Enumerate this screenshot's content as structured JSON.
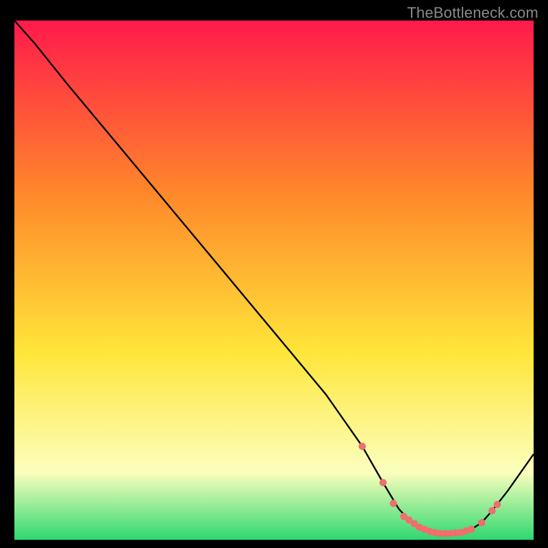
{
  "watermark": "TheBottleneck.com",
  "colors": {
    "bg": "#000000",
    "watermark": "#8a8a8a",
    "line": "#000000",
    "dot": "#ef6e6e",
    "grad_top": "#ff1a4b",
    "grad_orange": "#ff8a2a",
    "grad_yellow": "#ffe63a",
    "grad_lightyellow": "#fbffbd",
    "grad_green": "#2ed86f"
  },
  "chart_data": {
    "type": "line",
    "title": "",
    "xlabel": "",
    "ylabel": "",
    "xlim": [
      0,
      100
    ],
    "ylim": [
      0,
      100
    ],
    "series": [
      {
        "name": "curve",
        "x": [
          0,
          4,
          10,
          20,
          30,
          40,
          50,
          60,
          67,
          71,
          74,
          76,
          78,
          80,
          82,
          84,
          86,
          88,
          90,
          92,
          95,
          100
        ],
        "values": [
          100,
          95.5,
          88,
          76,
          64,
          52,
          40,
          28,
          18,
          11,
          6,
          3.8,
          2.4,
          1.6,
          1.2,
          1.2,
          1.4,
          2.0,
          3.3,
          5.6,
          9.4,
          16.5
        ]
      }
    ],
    "markers": {
      "name": "dots",
      "x": [
        67,
        71,
        73,
        75,
        76,
        77,
        78,
        79,
        80,
        81,
        82,
        83,
        84,
        85,
        86,
        87,
        88,
        90,
        92,
        93
      ],
      "values": [
        18,
        11,
        7,
        4.5,
        3.8,
        3.1,
        2.4,
        2.0,
        1.6,
        1.4,
        1.2,
        1.2,
        1.2,
        1.3,
        1.4,
        1.7,
        2.0,
        3.3,
        5.6,
        6.8
      ]
    }
  }
}
